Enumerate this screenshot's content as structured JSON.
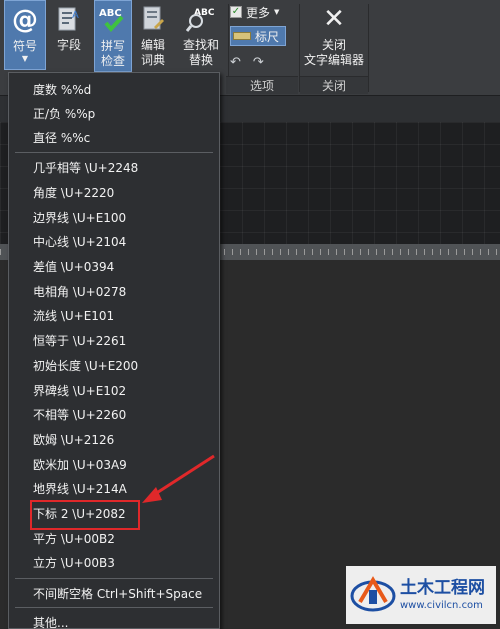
{
  "ribbon": {
    "buttons": {
      "symbol": "符号",
      "field": "字段",
      "spell_line1": "拼写",
      "spell_line2": "检查",
      "edit_dict_line1": "编辑",
      "edit_dict_line2": "词典",
      "find_line1": "查找和",
      "find_line2": "替换",
      "close_line1": "关闭",
      "close_line2": "文字编辑器",
      "more": "更多",
      "ruler": "标尺"
    },
    "icons": {
      "symbol": "at-sign-icon",
      "spell": "spell-check-icon",
      "abc_text": "ABC"
    },
    "panels": {
      "options": "选项",
      "close": "关闭"
    }
  },
  "menu": {
    "items": [
      "度数  %%d",
      "正/负  %%p",
      "直径  %%c",
      "几乎相等  \\U+2248",
      "角度  \\U+2220",
      "边界线  \\U+E100",
      "中心线  \\U+2104",
      "差值  \\U+0394",
      "电相角  \\U+0278",
      "流线  \\U+E101",
      "恒等于  \\U+2261",
      "初始长度  \\U+E200",
      "界碑线  \\U+E102",
      "不相等  \\U+2260",
      "欧姆  \\U+2126",
      "欧米加  \\U+03A9",
      "地界线  \\U+214A",
      "下标 2  \\U+2082",
      "平方  \\U+00B2",
      "立方  \\U+00B3",
      "不间断空格 Ctrl+Shift+Space",
      "其他..."
    ]
  },
  "watermark": {
    "title": "土木工程网",
    "url": "www.civilcn.com"
  },
  "colors": {
    "highlight": "#e0282a",
    "accent": "#4f79ad"
  }
}
